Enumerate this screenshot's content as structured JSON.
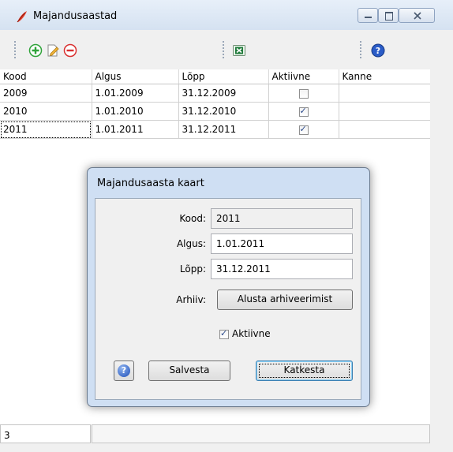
{
  "window": {
    "title": "Majandusaastad"
  },
  "toolbar": {
    "icons": [
      "add-icon",
      "edit-icon",
      "remove-icon",
      "excel-icon",
      "help-icon"
    ],
    "help_glyph": "?"
  },
  "grid": {
    "columns": [
      "Kood",
      "Algus",
      "Lõpp",
      "Aktiivne",
      "Kanne"
    ],
    "rows": [
      {
        "kood": "2009",
        "algus": "1.01.2009",
        "lopp": "31.12.2009",
        "aktiivne": false,
        "kanne": ""
      },
      {
        "kood": "2010",
        "algus": "1.01.2010",
        "lopp": "31.12.2010",
        "aktiivne": true,
        "kanne": ""
      },
      {
        "kood": "2011",
        "algus": "1.01.2011",
        "lopp": "31.12.2011",
        "aktiivne": true,
        "kanne": ""
      }
    ]
  },
  "status": {
    "count": "3"
  },
  "dialog": {
    "title": "Majandusaasta kaart",
    "kood_label": "Kood:",
    "kood_value": "2011",
    "algus_label": "Algus:",
    "algus_value": "1.01.2011",
    "lopp_label": "Lõpp:",
    "lopp_value": "31.12.2011",
    "arhiiv_label": "Arhiiv:",
    "archive_button": "Alusta arhiveerimist",
    "aktiivne_label": "Aktiivne",
    "aktiivne_checked": true,
    "save_button": "Salvesta",
    "cancel_button": "Katkesta",
    "help_glyph": "?"
  },
  "colors": {
    "accent": "#2b4a8c",
    "add": "#2fa33a",
    "remove": "#d93030",
    "excel": "#1f7a3a"
  }
}
